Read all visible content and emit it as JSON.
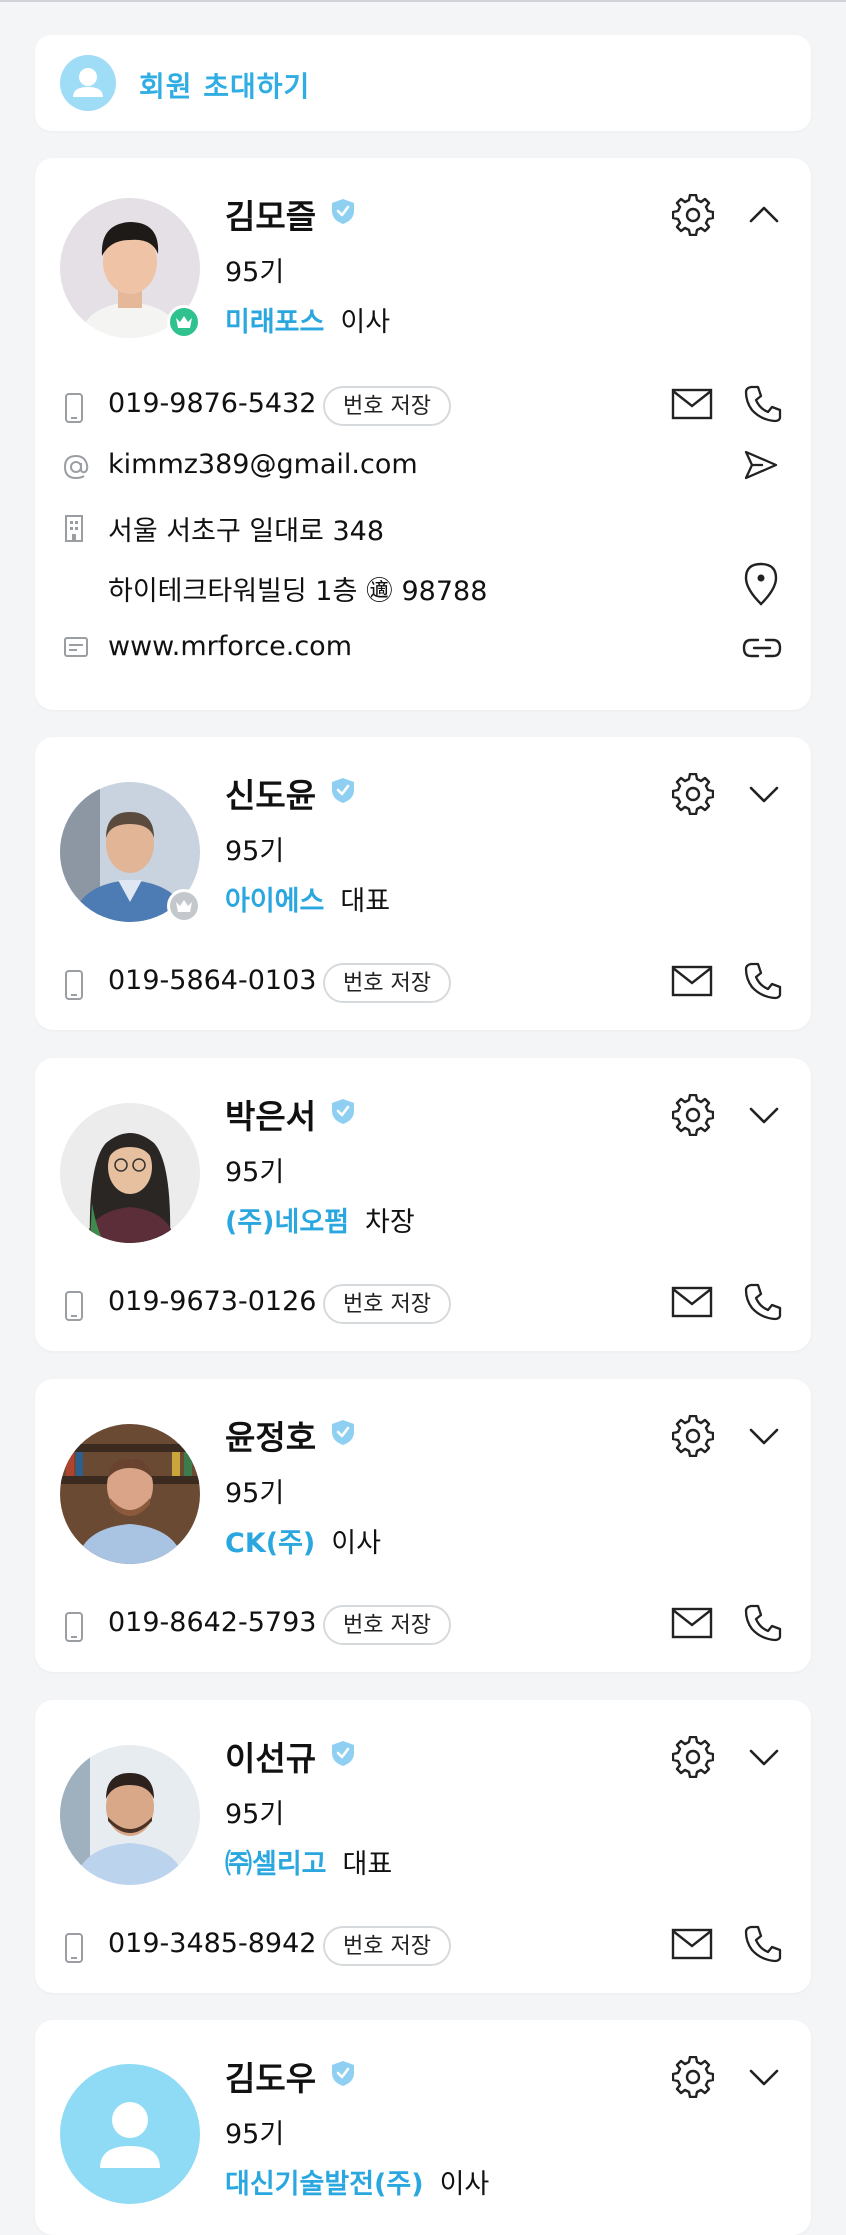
{
  "invite": {
    "label": "회원 초대하기"
  },
  "save_label": "번호 저장",
  "members": [
    {
      "name": "김모즐",
      "generation": "95기",
      "company": "미래포스",
      "title": "이사",
      "phone": "019-9876-5432",
      "email": "kimmz389@gmail.com",
      "address1": "서울 서초구 일대로 348",
      "address2": "하이테크타워빌딩 1층 ㊜ 98788",
      "website": "www.mrforce.com",
      "expanded": true,
      "crown": "green"
    },
    {
      "name": "신도윤",
      "generation": "95기",
      "company": "아이에스",
      "title": "대표",
      "phone": "019-5864-0103",
      "expanded": false,
      "crown": "gray"
    },
    {
      "name": "박은서",
      "generation": "95기",
      "company": "(주)네오펌",
      "title": "차장",
      "phone": "019-9673-0126",
      "expanded": false
    },
    {
      "name": "윤정호",
      "generation": "95기",
      "company": "CK(주)",
      "title": "이사",
      "phone": "019-8642-5793",
      "expanded": false
    },
    {
      "name": "이선규",
      "generation": "95기",
      "company": "㈜셀리고",
      "title": "대표",
      "phone": "019-3485-8942",
      "expanded": false
    },
    {
      "name": "김도우",
      "generation": "95기",
      "company": "대신기술발전(주)",
      "title": "이사",
      "expanded": false
    }
  ],
  "colors": {
    "accent": "#2aa7df",
    "verified": "#8fd0f2",
    "crown_green": "#2fc28e",
    "crown_gray": "#c4c8cc",
    "placeholder_avatar": "#9fdcf6"
  },
  "icons": [
    "user-icon",
    "verified-badge-icon",
    "gear-icon",
    "chevron-up-icon",
    "chevron-down-icon",
    "phone-device-icon",
    "mail-icon",
    "call-icon",
    "at-icon",
    "send-icon",
    "building-icon",
    "location-pin-icon",
    "web-icon",
    "link-icon",
    "crown-icon"
  ]
}
